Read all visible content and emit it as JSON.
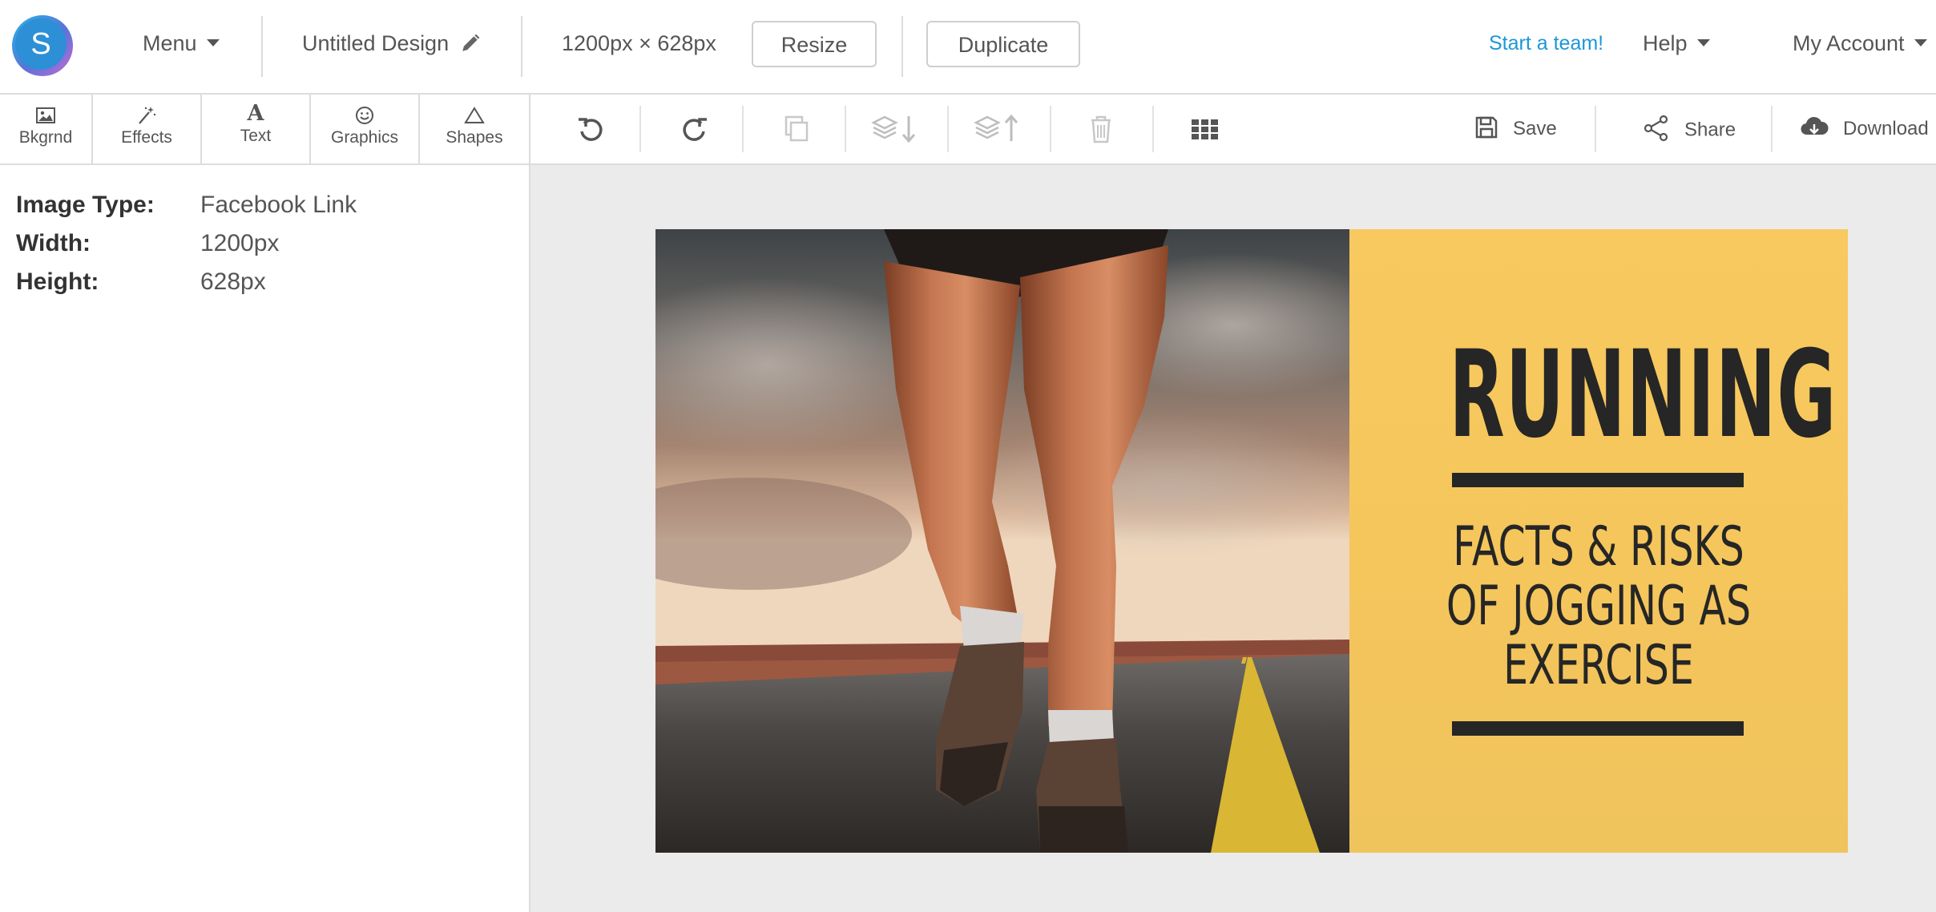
{
  "app": {
    "logo_letter": "S"
  },
  "topbar": {
    "menu_label": "Menu",
    "design_title": "Untitled Design",
    "dimensions": "1200px × 628px",
    "resize_label": "Resize",
    "duplicate_label": "Duplicate",
    "start_team_label": "Start a team!",
    "help_label": "Help",
    "account_label": "My Account"
  },
  "tooltabs": [
    "Bkgrnd",
    "Effects",
    "Text",
    "Graphics",
    "Shapes"
  ],
  "toolbar": {
    "save_label": "Save",
    "share_label": "Share",
    "download_label": "Download"
  },
  "properties": [
    {
      "key": "Image Type:",
      "value": "Facebook Link"
    },
    {
      "key": "Width:",
      "value": "1200px"
    },
    {
      "key": "Height:",
      "value": "628px"
    }
  ],
  "design": {
    "headline": "RUNNING",
    "subhead_line1": "FACTS & RISKS",
    "subhead_line2": "OF JOGGING AS",
    "subhead_line3": "EXERCISE"
  },
  "colors": {
    "accent_link": "#1d97d8",
    "design_yellow": "#f6c85e",
    "design_text": "#262626",
    "canvas_bg": "#ebebeb"
  }
}
